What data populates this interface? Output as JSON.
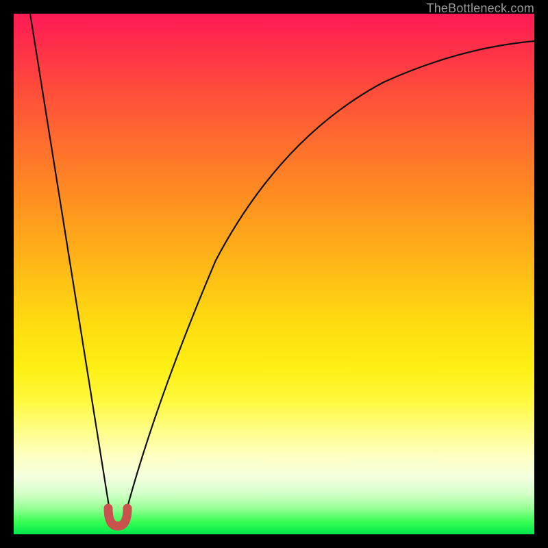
{
  "watermark": "TheBottleneck.com",
  "colors": {
    "background": "#000000",
    "gradient_top": "#ff1a54",
    "gradient_bottom": "#00e84a",
    "curve": "#101010",
    "marker": "#c9524f"
  },
  "chart_data": {
    "type": "line",
    "title": "",
    "xlabel": "",
    "ylabel": "",
    "xlim": [
      0,
      100
    ],
    "ylim": [
      0,
      100
    ],
    "note": "Axis tick labels are not visible in the image; data points are estimated from the visible curve shape. y represents vertical position from bottom (0) to top (100).",
    "series": [
      {
        "name": "bottleneck-curve",
        "x": [
          3,
          5,
          7,
          9,
          11,
          13,
          15,
          17,
          18.5,
          20,
          21.5,
          23,
          25,
          28,
          32,
          36,
          41,
          46,
          52,
          58,
          65,
          73,
          82,
          91,
          100
        ],
        "y": [
          100,
          88,
          76,
          64,
          52,
          40,
          28,
          16,
          7,
          2,
          7,
          16,
          28,
          42,
          56,
          66,
          74,
          80,
          84,
          87.5,
          90,
          92,
          93.5,
          94.5,
          95
        ]
      }
    ],
    "annotations": [
      {
        "name": "minimum-marker",
        "shape": "u-mark",
        "x": 20,
        "y": 2,
        "color": "#c9524f"
      }
    ]
  }
}
